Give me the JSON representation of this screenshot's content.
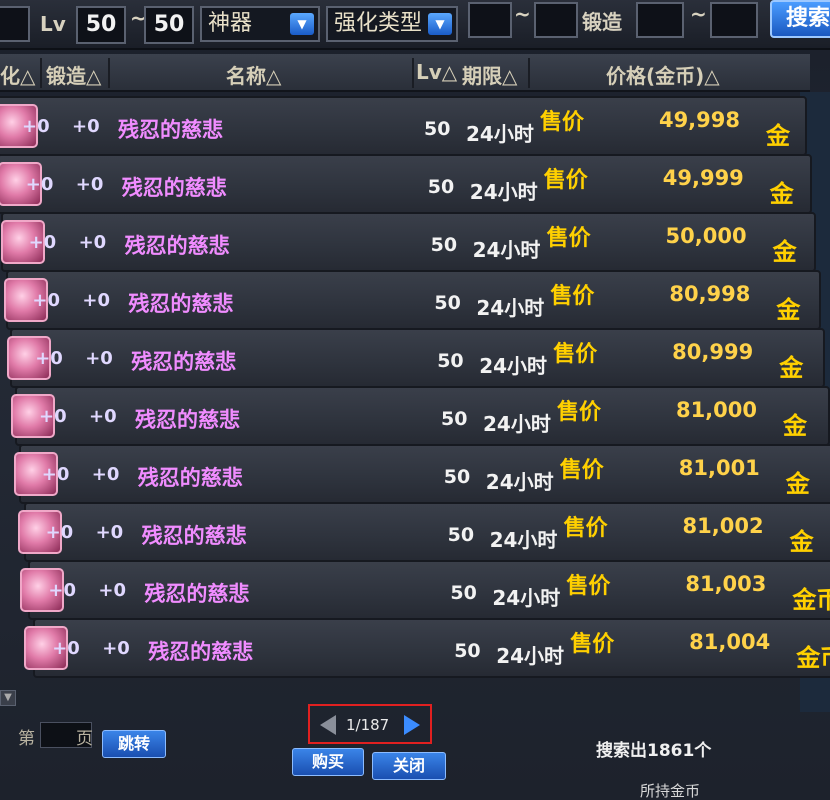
{
  "filters": {
    "lv_label": "Lv",
    "lv_min": "50",
    "tilde": "~",
    "lv_max": "50",
    "rarity": "神器",
    "enhance_type": "强化类型",
    "forge_label": "锻造",
    "search_button": "搜索"
  },
  "columns": {
    "enhance": "化△",
    "forge": "锻造△",
    "name": "名称△",
    "lv": "Lv△",
    "period": "期限△",
    "price": "价格(金币)△"
  },
  "rows": [
    {
      "enhance": "+0",
      "forge": "+0",
      "name": "残忍的慈悲",
      "lv": "50",
      "period": "24小时",
      "sell": "售价",
      "price": "49,998",
      "currency": "金币"
    },
    {
      "enhance": "+0",
      "forge": "+0",
      "name": "残忍的慈悲",
      "lv": "50",
      "period": "24小时",
      "sell": "售价",
      "price": "49,999",
      "currency": "金币"
    },
    {
      "enhance": "+0",
      "forge": "+0",
      "name": "残忍的慈悲",
      "lv": "50",
      "period": "24小时",
      "sell": "售价",
      "price": "50,000",
      "currency": "金币"
    },
    {
      "enhance": "+0",
      "forge": "+0",
      "name": "残忍的慈悲",
      "lv": "50",
      "period": "24小时",
      "sell": "售价",
      "price": "80,998",
      "currency": "金币"
    },
    {
      "enhance": "+0",
      "forge": "+0",
      "name": "残忍的慈悲",
      "lv": "50",
      "period": "24小时",
      "sell": "售价",
      "price": "80,999",
      "currency": "金币"
    },
    {
      "enhance": "+0",
      "forge": "+0",
      "name": "残忍的慈悲",
      "lv": "50",
      "period": "24小时",
      "sell": "售价",
      "price": "81,000",
      "currency": "金币"
    },
    {
      "enhance": "+0",
      "forge": "+0",
      "name": "残忍的慈悲",
      "lv": "50",
      "period": "24小时",
      "sell": "售价",
      "price": "81,001",
      "currency": "金币"
    },
    {
      "enhance": "+0",
      "forge": "+0",
      "name": "残忍的慈悲",
      "lv": "50",
      "period": "24小时",
      "sell": "售价",
      "price": "81,002",
      "currency": "金币"
    },
    {
      "enhance": "+0",
      "forge": "+0",
      "name": "残忍的慈悲",
      "lv": "50",
      "period": "24小时",
      "sell": "售价",
      "price": "81,003",
      "currency": "金币"
    },
    {
      "enhance": "+0",
      "forge": "+0",
      "name": "残忍的慈悲",
      "lv": "50",
      "period": "24小时",
      "sell": "售价",
      "price": "81,004",
      "currency": "金币"
    }
  ],
  "pager": {
    "text": "1/187"
  },
  "bottom": {
    "page_prefix": "第",
    "page_suffix": "页",
    "jump": "跳转",
    "buy": "购买",
    "close": "关闭",
    "found": "搜索出1861个",
    "footer": "所持金币"
  },
  "colors": {
    "item_name": "#f08cff",
    "price": "#ffd24a",
    "currency": "#ffd000",
    "pager_highlight": "#e02020"
  }
}
